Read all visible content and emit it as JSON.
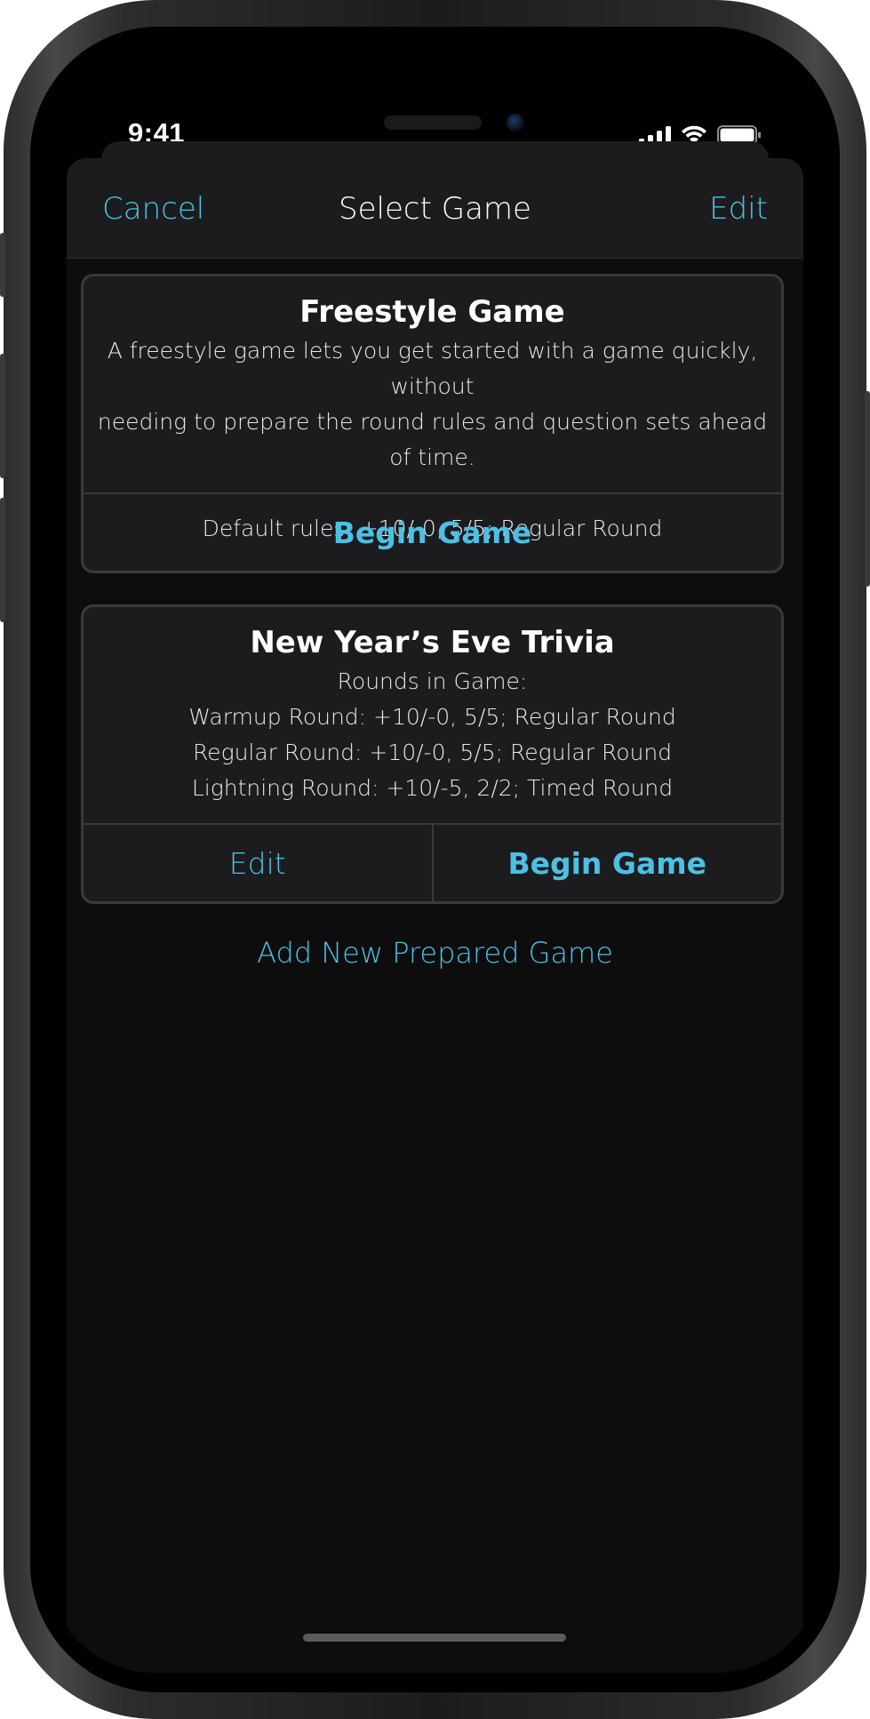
{
  "status_bar": {
    "time": "9:41",
    "icons": [
      "cellular-signal-icon",
      "wifi-icon",
      "battery-icon"
    ]
  },
  "navbar": {
    "cancel_label": "Cancel",
    "title": "Select Game",
    "edit_label": "Edit"
  },
  "freestyle_card": {
    "title": "Freestyle Game",
    "description_line1": "A freestyle game lets you get started with a game quickly, without",
    "description_line2": "needing to prepare the round rules and question sets ahead of time.",
    "default_rules": "Default rules: +10/-0, 5/5; Regular Round",
    "begin_label": "Begin Game"
  },
  "prepared_games": [
    {
      "title": "New Year’s Eve Trivia",
      "rounds_heading": "Rounds in Game:",
      "rounds": [
        "Warmup Round: +10/-0, 5/5; Regular Round",
        "Regular Round: +10/-0, 5/5; Regular Round",
        "Lightning Round: +10/-5, 2/2; Timed Round"
      ],
      "edit_label": "Edit",
      "begin_label": "Begin Game"
    }
  ],
  "add_prepared_game_label": "Add New Prepared Game",
  "colors": {
    "accent": "#4cc0e6",
    "background": "#000000",
    "card": "#1c1c1e",
    "border": "#3a3a3c"
  }
}
